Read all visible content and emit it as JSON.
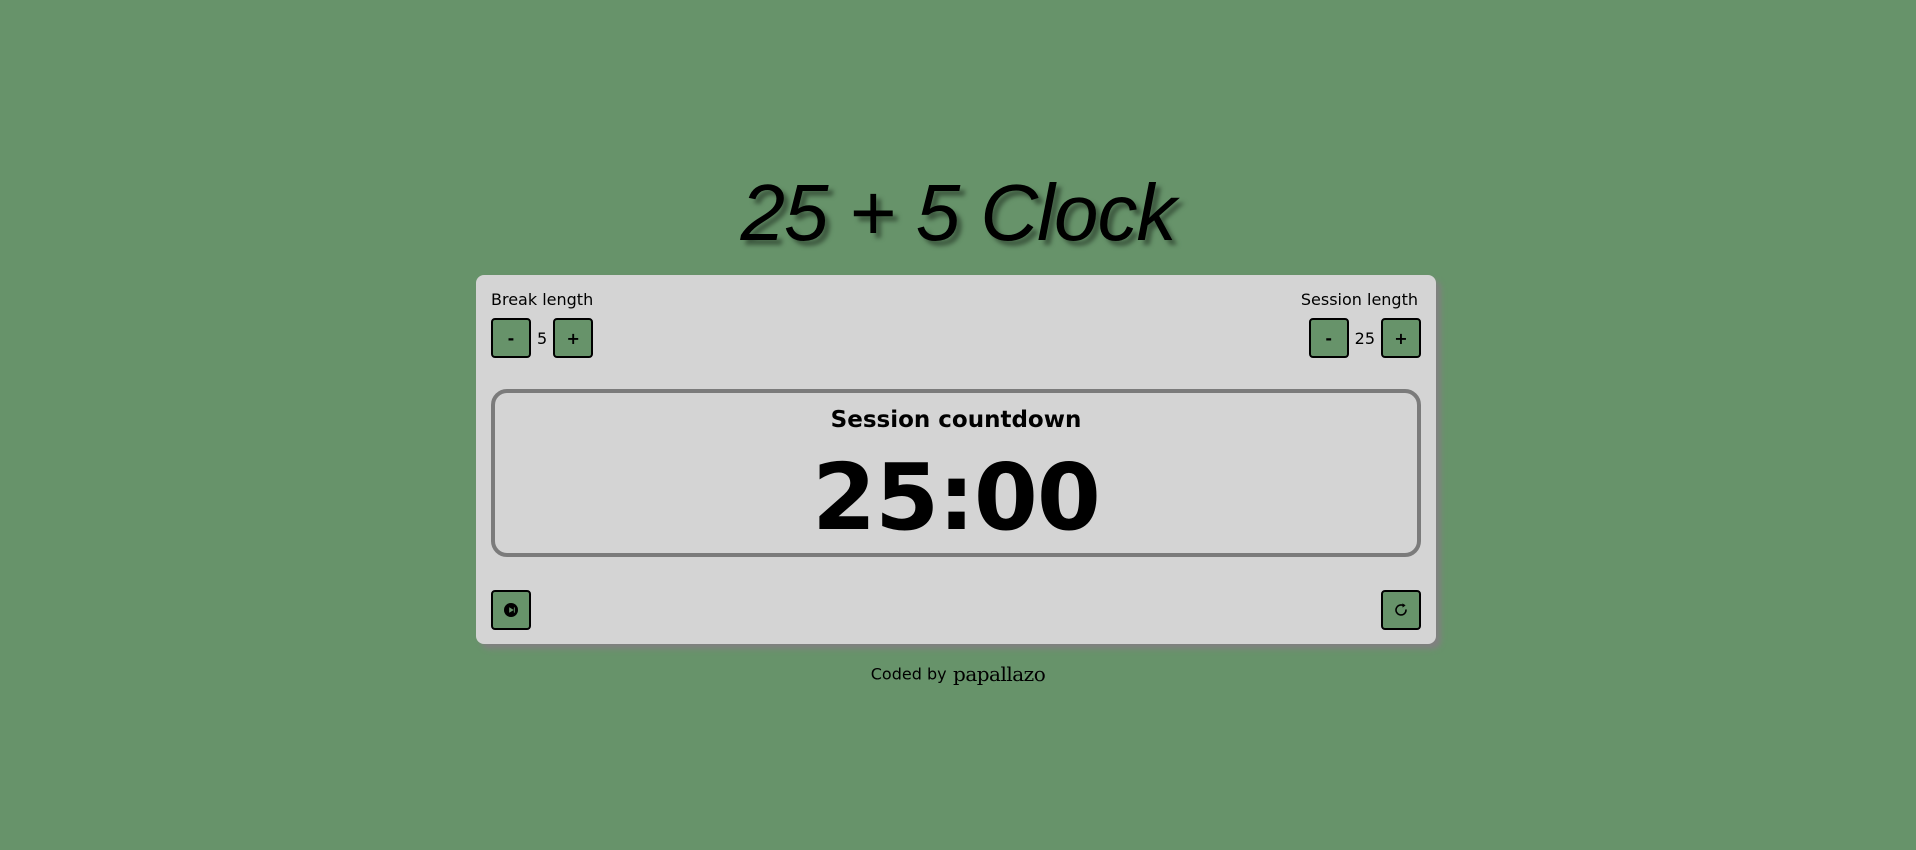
{
  "app": {
    "title": "25 + 5 Clock"
  },
  "break_length": {
    "label": "Break length",
    "decrement_label": "-",
    "increment_label": "+",
    "value": "5"
  },
  "session_length": {
    "label": "Session length",
    "decrement_label": "-",
    "increment_label": "+",
    "value": "25"
  },
  "timer": {
    "label": "Session countdown",
    "time": "25:00"
  },
  "controls": {
    "play_icon": "play-pause-icon",
    "reset_icon": "refresh-icon"
  },
  "footer": {
    "text": "Coded by",
    "author": "papallazo"
  },
  "colors": {
    "background": "#67936a",
    "card": "#d4d4d4",
    "button": "#67936a",
    "timer_border": "#7b7b7b"
  }
}
